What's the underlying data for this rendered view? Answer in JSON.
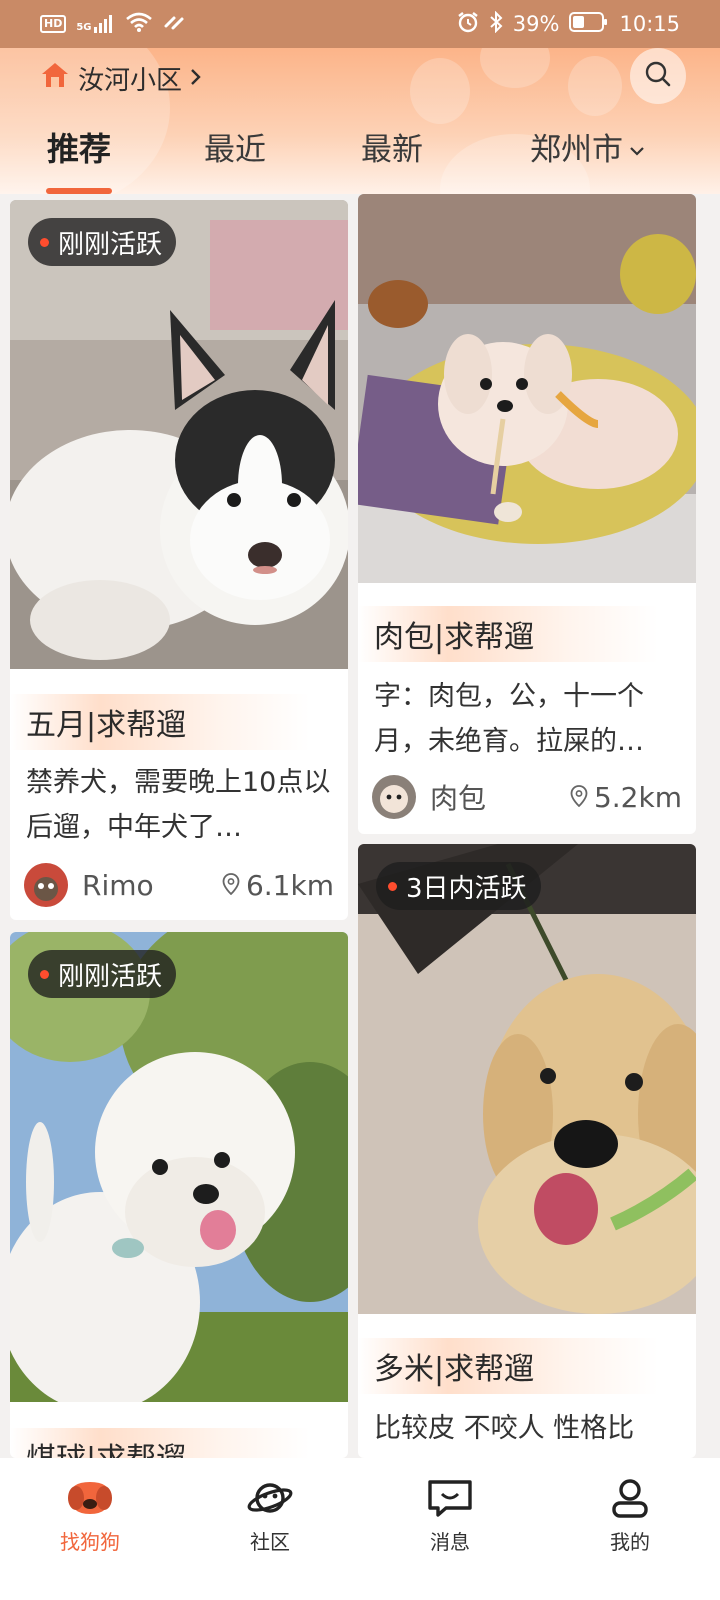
{
  "status_bar": {
    "hd": "HD",
    "network": "5G",
    "battery": "39%",
    "time": "10:15"
  },
  "header": {
    "location": "汝河小区",
    "tabs": [
      {
        "label": "推荐",
        "active": true
      },
      {
        "label": "最近",
        "active": false
      },
      {
        "label": "最新",
        "active": false
      },
      {
        "label": "郑州市",
        "active": false,
        "dropdown": true
      }
    ],
    "accent_color": "#f1663c"
  },
  "feed": {
    "cards": [
      {
        "badge": "刚刚活跃",
        "title": "五月|求帮遛",
        "description": "禁养犬，需要晚上10点以后遛，中年犬了…",
        "owner": "Rimo",
        "distance": "6.1km"
      },
      {
        "badge": "",
        "title": "肉包|求帮遛",
        "description": "字：肉包，公，十一个月，未绝育。拉屎的…",
        "owner": "肉包",
        "distance": "5.2km"
      },
      {
        "badge": "刚刚活跃",
        "title": "煤球|求帮遛",
        "description": "",
        "owner": "",
        "distance": ""
      },
      {
        "badge": "3日内活跃",
        "title": "多米|求帮遛",
        "description": "比较皮 不咬人 性格比",
        "owner": "",
        "distance": ""
      }
    ]
  },
  "bottom_nav": {
    "items": [
      {
        "label": "找狗狗",
        "icon": "dog-face-icon",
        "active": true
      },
      {
        "label": "社区",
        "icon": "planet-icon",
        "active": false
      },
      {
        "label": "消息",
        "icon": "chat-bubble-icon",
        "active": false
      },
      {
        "label": "我的",
        "icon": "user-icon",
        "active": false
      }
    ]
  }
}
